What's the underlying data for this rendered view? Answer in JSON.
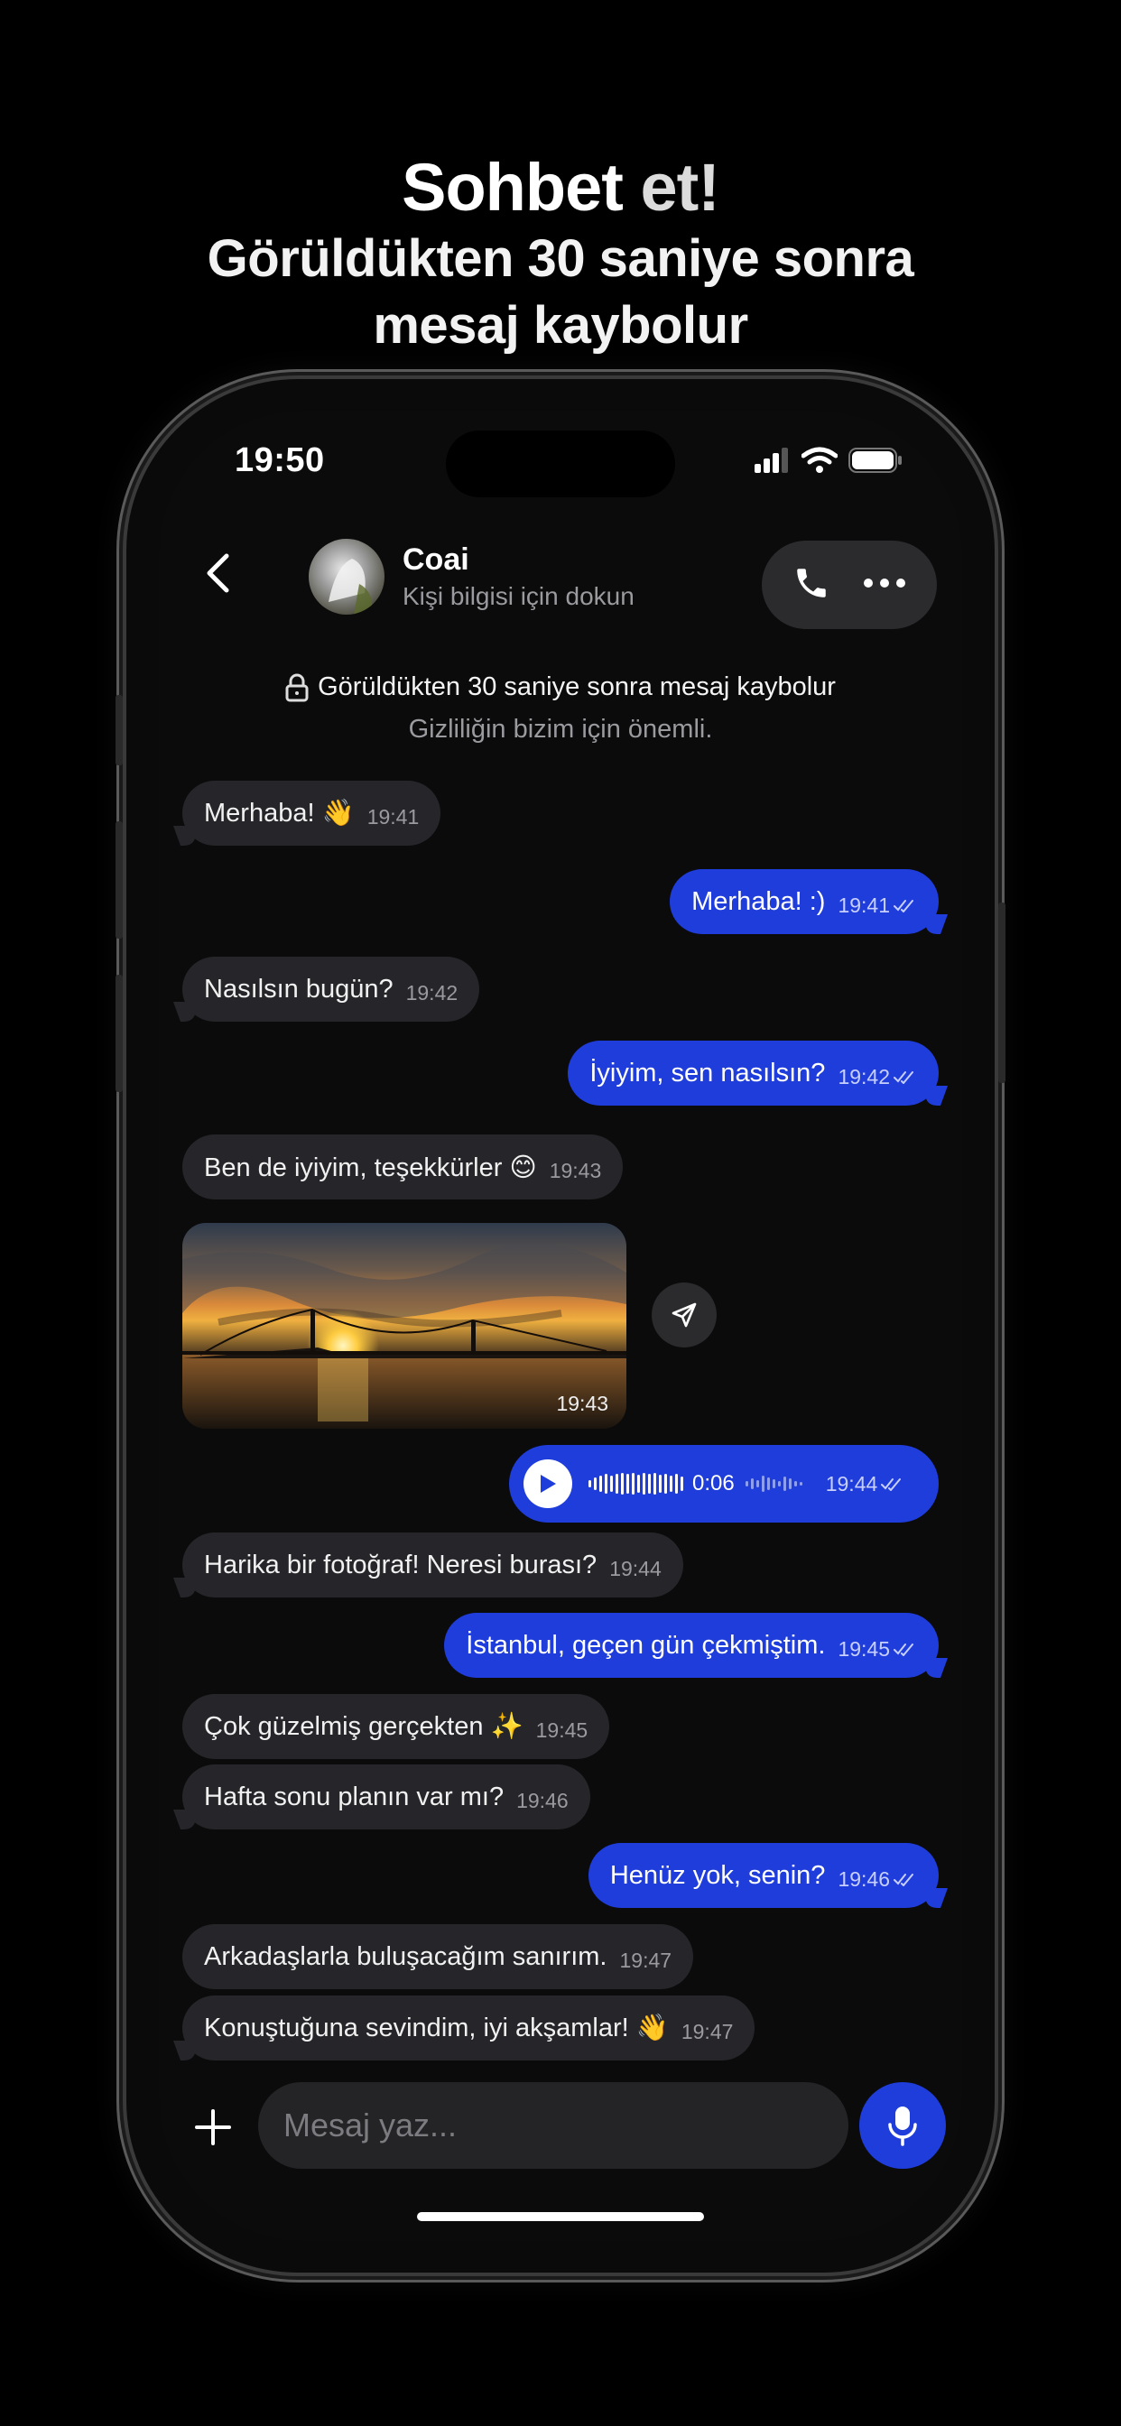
{
  "promo": {
    "title_bold": "Sohbet",
    "title_light": "et!",
    "subtitle_line1": "Görüldükten 30 saniye sonra",
    "subtitle_line2": "mesaj kaybolur"
  },
  "status_bar": {
    "time": "19:50"
  },
  "header": {
    "contact_name": "Coai",
    "contact_subtitle": "Kişi bilgisi için dokun"
  },
  "notice": {
    "line1": "Görüldükten 30 saniye sonra mesaj kaybolur",
    "line2": "Gizliliğin bizim için önemli."
  },
  "messages": [
    {
      "dir": "in",
      "text": "Merhaba! 👋",
      "time": "19:41"
    },
    {
      "dir": "out",
      "text": "Merhaba! :)",
      "time": "19:41",
      "read": true
    },
    {
      "dir": "in",
      "text": "Nasılsın bugün?",
      "time": "19:42"
    },
    {
      "dir": "out",
      "text": "İyiyim, sen nasılsın?",
      "time": "19:42",
      "read": true
    },
    {
      "dir": "in",
      "text": "Ben de iyiyim, teşekkürler 😊",
      "time": "19:43"
    },
    {
      "dir": "in",
      "type": "image",
      "time": "19:43"
    },
    {
      "dir": "out",
      "type": "voice",
      "duration": "0:06",
      "time": "19:44",
      "read": true
    },
    {
      "dir": "in",
      "text": "Harika bir fotoğraf! Neresi burası?",
      "time": "19:44"
    },
    {
      "dir": "out",
      "text": "İstanbul, geçen gün çekmiştim.",
      "time": "19:45",
      "read": true
    },
    {
      "dir": "in",
      "text": "Çok güzelmiş gerçekten ✨",
      "time": "19:45"
    },
    {
      "dir": "in",
      "text": "Hafta sonu planın var mı?",
      "time": "19:46"
    },
    {
      "dir": "out",
      "text": "Henüz yok, senin?",
      "time": "19:46",
      "read": true
    },
    {
      "dir": "in",
      "text": "Arkadaşlarla buluşacağım sanırım.",
      "time": "19:47"
    },
    {
      "dir": "in",
      "text": "Konuştuğuna sevindim, iyi akşamlar! 👋",
      "time": "19:47"
    }
  ],
  "composer": {
    "placeholder": "Mesaj yaz..."
  },
  "colors": {
    "accent": "#1f3ddb",
    "bubble_in": "#26262a",
    "background": "#0b0b0c"
  }
}
